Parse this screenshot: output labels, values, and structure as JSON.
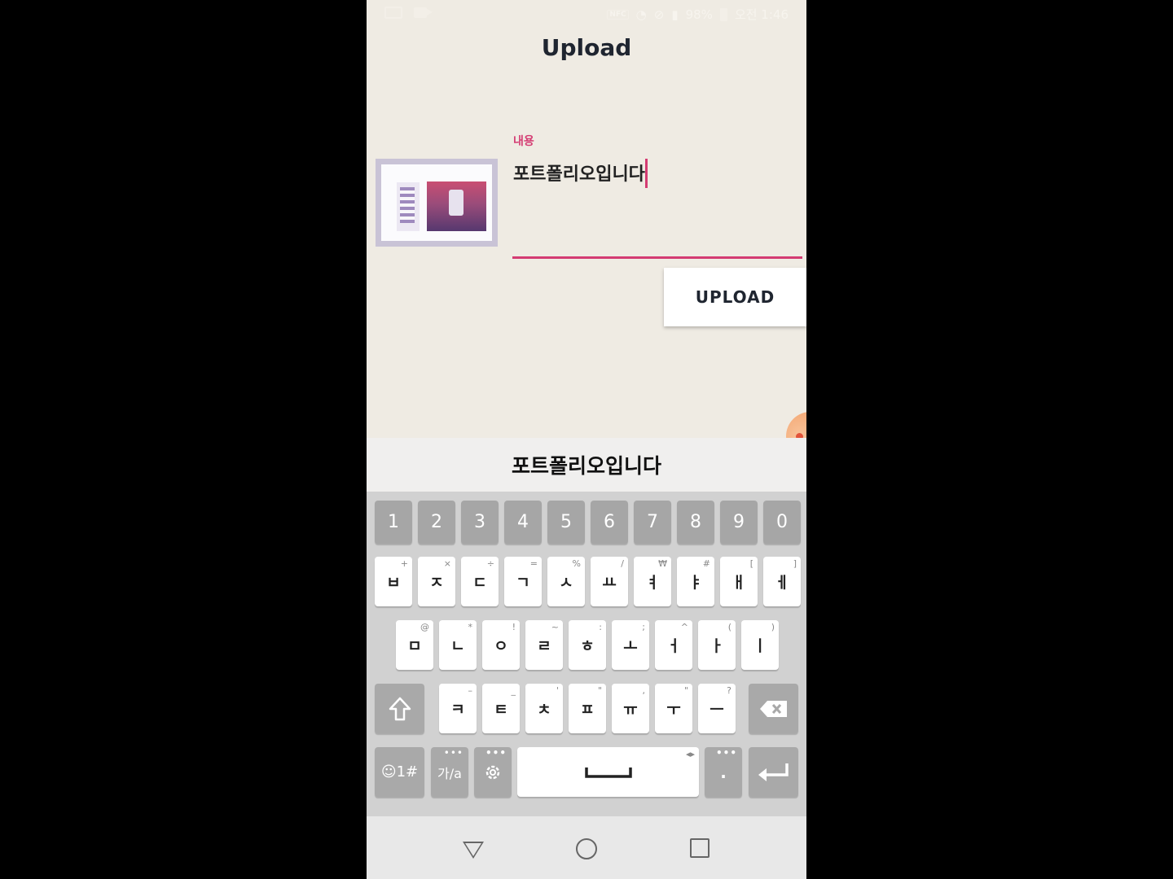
{
  "status_bar": {
    "nfc": "NFC",
    "battery": "98%",
    "time": "오전 1:46",
    "icons": [
      "keyboard-icon",
      "video-icon",
      "nfc-icon",
      "wifi-icon",
      "no-sim-icon",
      "signal-icon",
      "battery-icon"
    ]
  },
  "page": {
    "title": "Upload"
  },
  "form": {
    "label": "내용",
    "value": "포트폴리오입니다",
    "upload_label": "UPLOAD"
  },
  "suggestion": "포트폴리오입니다",
  "keyboard": {
    "numbers": [
      "1",
      "2",
      "3",
      "4",
      "5",
      "6",
      "7",
      "8",
      "9",
      "0"
    ],
    "row1": [
      {
        "main": "ㅂ",
        "sub": "+"
      },
      {
        "main": "ㅈ",
        "sub": "×"
      },
      {
        "main": "ㄷ",
        "sub": "÷"
      },
      {
        "main": "ㄱ",
        "sub": "="
      },
      {
        "main": "ㅅ",
        "sub": "%"
      },
      {
        "main": "ㅛ",
        "sub": "/"
      },
      {
        "main": "ㅕ",
        "sub": "₩"
      },
      {
        "main": "ㅑ",
        "sub": "#"
      },
      {
        "main": "ㅐ",
        "sub": "["
      },
      {
        "main": "ㅔ",
        "sub": "]"
      }
    ],
    "row2": [
      {
        "main": "ㅁ",
        "sub": "@"
      },
      {
        "main": "ㄴ",
        "sub": "*"
      },
      {
        "main": "ㅇ",
        "sub": "!"
      },
      {
        "main": "ㄹ",
        "sub": "~"
      },
      {
        "main": "ㅎ",
        "sub": ":"
      },
      {
        "main": "ㅗ",
        "sub": ";"
      },
      {
        "main": "ㅓ",
        "sub": "^"
      },
      {
        "main": "ㅏ",
        "sub": "("
      },
      {
        "main": "ㅣ",
        "sub": ")"
      }
    ],
    "row3": [
      {
        "main": "ㅋ",
        "sub": "–"
      },
      {
        "main": "ㅌ",
        "sub": "_"
      },
      {
        "main": "ㅊ",
        "sub": "'"
      },
      {
        "main": "ㅍ",
        "sub": "\""
      },
      {
        "main": "ㅠ",
        "sub": ","
      },
      {
        "main": "ㅜ",
        "sub": "\""
      },
      {
        "main": "ㅡ",
        "sub": "?"
      }
    ],
    "symbols_label": "☺1#",
    "lang_label": "가/a",
    "period": "."
  },
  "colors": {
    "accent": "#d43b72",
    "background": "#efebe3",
    "key": "#ffffff",
    "func_key": "#a9a9a9"
  }
}
